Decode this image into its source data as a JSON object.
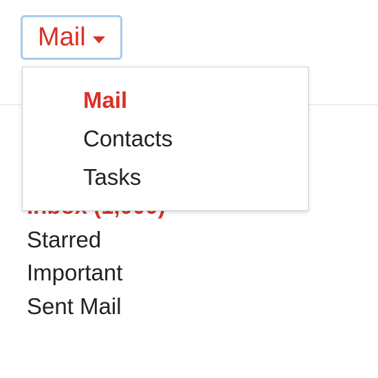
{
  "appSwitcher": {
    "label": "Mail",
    "menu": {
      "items": [
        {
          "label": "Mail",
          "active": true
        },
        {
          "label": "Contacts",
          "active": false
        },
        {
          "label": "Tasks",
          "active": false
        }
      ]
    }
  },
  "sidebar": {
    "items": [
      {
        "label": "Inbox (1,000)",
        "key": "inbox"
      },
      {
        "label": "Starred",
        "key": "starred"
      },
      {
        "label": "Important",
        "key": "important"
      },
      {
        "label": "Sent Mail",
        "key": "sent-mail"
      }
    ]
  },
  "colors": {
    "accent": "#d93025",
    "focusBorder": "#a9cceb",
    "text": "#222222"
  }
}
